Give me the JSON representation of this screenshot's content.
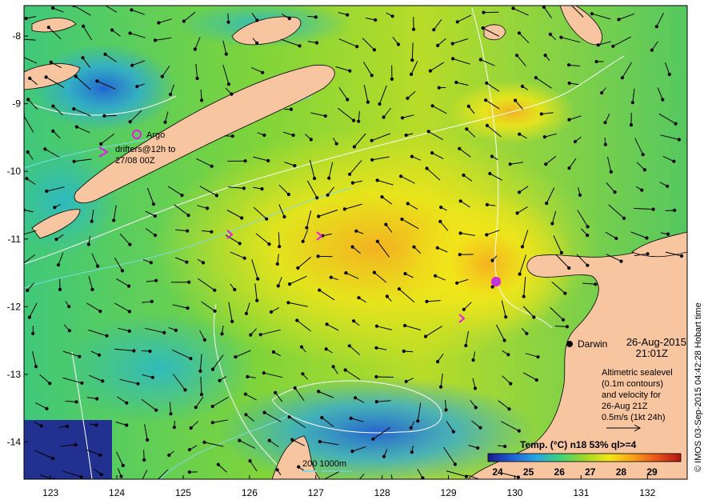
{
  "map": {
    "lon_ticks": [
      "123",
      "124",
      "125",
      "126",
      "127",
      "128",
      "129",
      "130",
      "131",
      "132"
    ],
    "lat_ticks": [
      "-8",
      "-9",
      "-10",
      "-11",
      "-12",
      "-13",
      "-14"
    ],
    "lon_range": [
      122.6,
      132.6
    ],
    "lat_range": [
      -14.55,
      -7.55
    ]
  },
  "legend_markers": {
    "argo_label": "Argo",
    "drifters_line1": "drifters@12h to",
    "drifters_line2": "27/08 00Z"
  },
  "place": {
    "city": "Darwin"
  },
  "stamp": {
    "date": "26-Aug-2015",
    "time": "21:01Z"
  },
  "info": {
    "line1": "Altimetric sealevel",
    "line2": "(0.1m contours)",
    "line3": "and velocity for",
    "line4": "26-Aug 21Z",
    "line5": "0.5m/s (1kt 24h)"
  },
  "scale": {
    "label": "200  1000m"
  },
  "colorbar": {
    "title": "Temp. (°C) n18 53% ql>=4",
    "ticks": [
      "24",
      "25",
      "26",
      "27",
      "28",
      "29"
    ],
    "stops": [
      "#1a1a8c",
      "#1f5fd6",
      "#2aa6e0",
      "#3fd17a",
      "#9bd62a",
      "#f2e619",
      "#f7a318",
      "#e8531a",
      "#b01414"
    ]
  },
  "credit": "© IMOS 03-Sep-2015 04:42:28 Hobart time",
  "colors": {
    "land": "#f7c59f",
    "marker": "#e619e6",
    "contour": "#ffffff",
    "depth_contour": "#7fd9e6"
  }
}
